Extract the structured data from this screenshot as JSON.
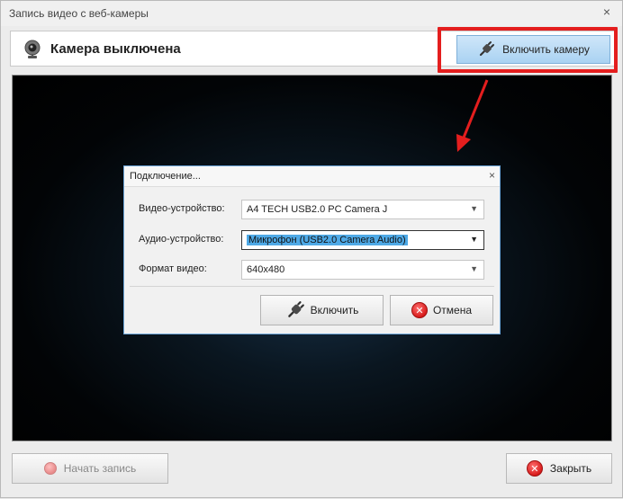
{
  "window": {
    "title": "Запись видео с веб-камеры",
    "close_glyph": "×"
  },
  "header": {
    "status": "Камера выключена",
    "enable_camera_label": "Включить камеру"
  },
  "dialog": {
    "title": "Подключение...",
    "close_glyph": "×",
    "fields": [
      {
        "label": "Видео-устройство:",
        "value": "A4 TECH USB2.0 PC Camera J"
      },
      {
        "label": "Аудио-устройство:",
        "value": "Микрофон (USB2.0 Camera Audio)"
      },
      {
        "label": "Формат видео:",
        "value": "640x480"
      }
    ],
    "enable_label": "Включить",
    "cancel_label": "Отмена"
  },
  "footer": {
    "start_record_label": "Начать запись",
    "close_label": "Закрыть"
  },
  "colors": {
    "highlight": "#e41e1e",
    "accent_button": "#a9d2f2",
    "selection": "#4ea9e6"
  }
}
